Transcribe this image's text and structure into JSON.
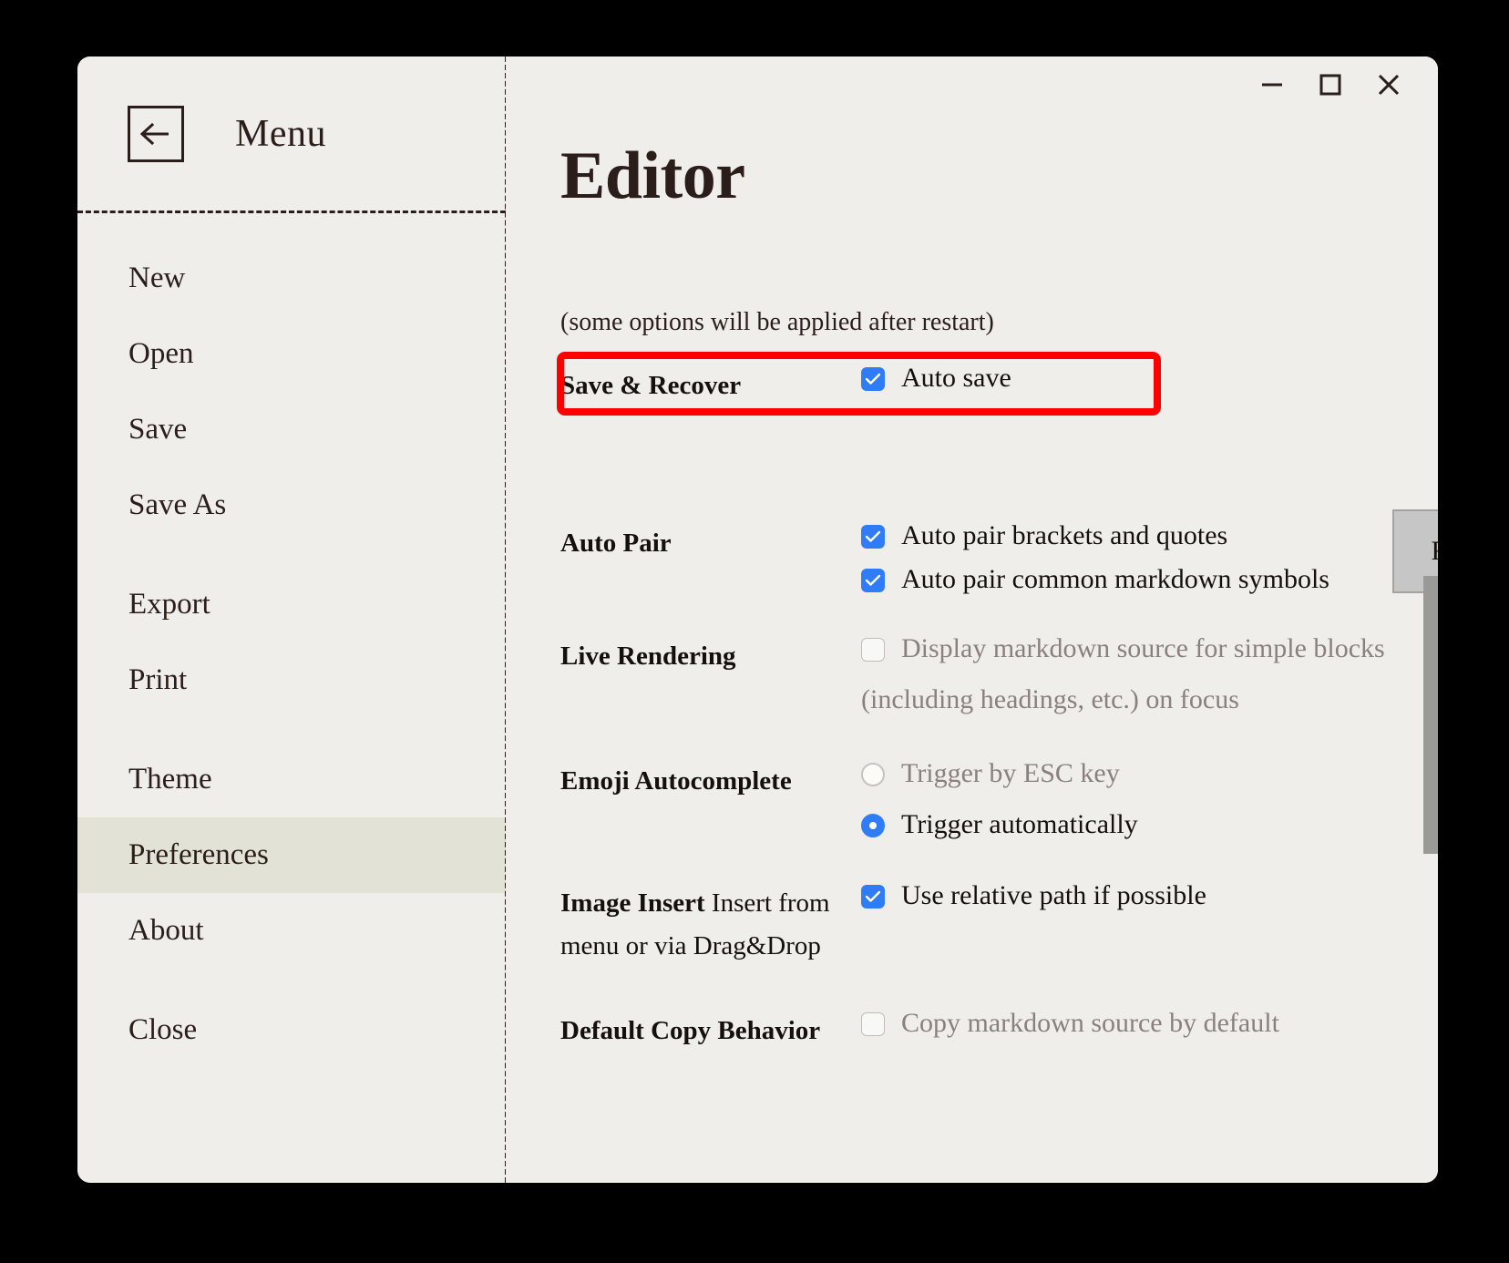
{
  "window": {
    "controls": {
      "minimize_label": "Minimize",
      "maximize_label": "Maximize",
      "close_label": "Close"
    }
  },
  "sidebar": {
    "back_label": "Back",
    "title": "Menu",
    "items": [
      {
        "label": "New",
        "active": false
      },
      {
        "label": "Open",
        "active": false
      },
      {
        "label": "Save",
        "active": false
      },
      {
        "label": "Save As",
        "active": false
      },
      {
        "label": "Export",
        "active": false
      },
      {
        "label": "Print",
        "active": false
      },
      {
        "label": "Theme",
        "active": false
      },
      {
        "label": "Preferences",
        "active": true
      },
      {
        "label": "About",
        "active": false
      },
      {
        "label": "Close",
        "active": false
      }
    ]
  },
  "main": {
    "title": "Editor",
    "note": "(some options will be applied after restart)",
    "settings": [
      {
        "label": "Save & Recover",
        "label_suffix": "",
        "options": [
          {
            "type": "checkbox",
            "checked": true,
            "disabled": false,
            "text": "Auto save"
          }
        ]
      },
      {
        "label": "Auto Pair",
        "label_suffix": "",
        "options": [
          {
            "type": "checkbox",
            "checked": true,
            "disabled": false,
            "text": "Auto pair brackets and quotes"
          },
          {
            "type": "checkbox",
            "checked": true,
            "disabled": false,
            "text": "Auto pair common markdown symbols"
          }
        ]
      },
      {
        "label": "Live Rendering",
        "label_suffix": "",
        "options": [
          {
            "type": "checkbox",
            "checked": false,
            "disabled": true,
            "text": "Display markdown source for simple blocks",
            "wrap_text": "(including headings, etc.) on focus"
          }
        ]
      },
      {
        "label": "Emoji Autocomplete",
        "label_suffix": "",
        "options": [
          {
            "type": "radio",
            "checked": false,
            "disabled": true,
            "text": "Trigger by ESC key"
          },
          {
            "type": "radio",
            "checked": true,
            "disabled": false,
            "text": "Trigger automatically"
          }
        ]
      },
      {
        "label": "Image Insert",
        "label_suffix": " Insert from menu or via Drag&Drop",
        "options": [
          {
            "type": "checkbox",
            "checked": true,
            "disabled": false,
            "text": "Use relative path if possible"
          }
        ]
      },
      {
        "label": "Default Copy Behavior",
        "label_suffix": "",
        "options": [
          {
            "type": "checkbox",
            "checked": false,
            "disabled": true,
            "text": "Copy markdown source by default"
          }
        ]
      }
    ],
    "recover_button_label": "Recover Unsaved Drafts"
  },
  "annotation": {
    "highlight_color": "#ff0000",
    "highlight_target": "Save & Recover"
  },
  "colors": {
    "window_bg": "#efeeea",
    "sidebar_active": "#e2e2d7",
    "accent_blue": "#2f7cf6",
    "text": "#15100e",
    "text_disabled": "#8a807d",
    "button_gray": "#c6c6c6",
    "scrollbar": "#9a9a96"
  }
}
